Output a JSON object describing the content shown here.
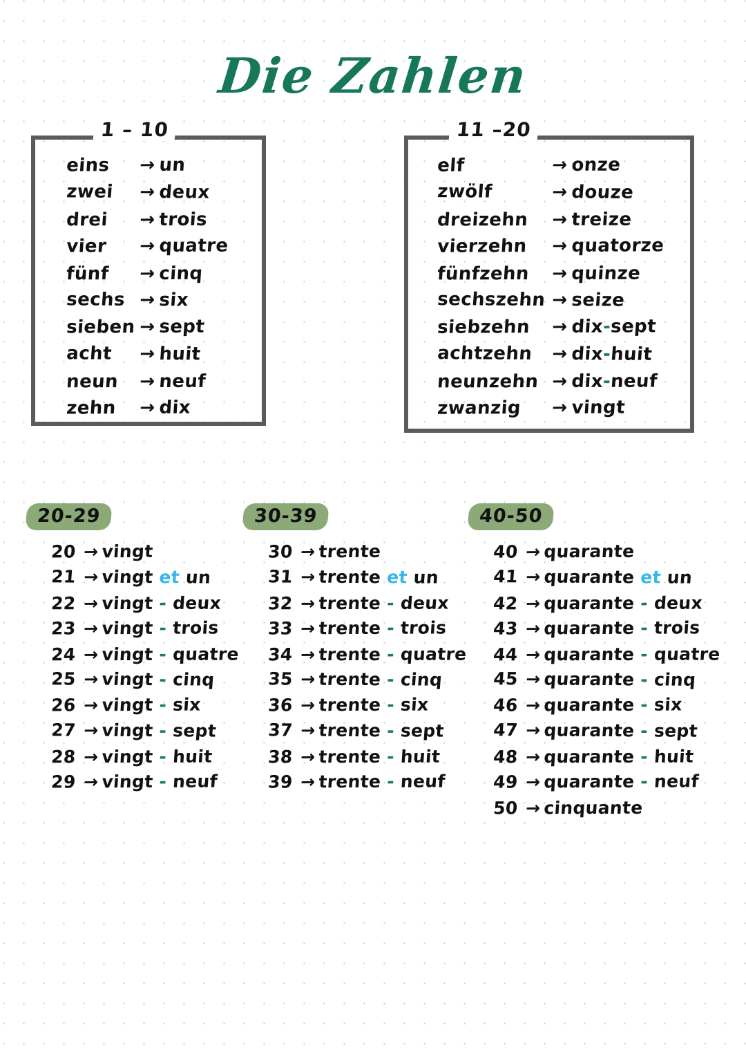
{
  "page": {
    "title": "Die Zahlen",
    "background": "#ffffff",
    "dot_grid_color": "#c9c9cf"
  },
  "colors": {
    "title_green": "#17775a",
    "highlight_pill_green": "#8ca978",
    "dash_green": "#167d63",
    "et_blue": "#3ab5e8",
    "box_border_gray": "#5b5b5b",
    "ink_black": "#111111"
  },
  "arrow_glyph": "→",
  "boxes": [
    {
      "legend": "1 – 10",
      "pairs": [
        {
          "de": "eins",
          "arrow": "→",
          "fr": "un"
        },
        {
          "de": "zwei",
          "arrow": "→",
          "fr": "deux"
        },
        {
          "de": "drei",
          "arrow": "→",
          "fr": "trois"
        },
        {
          "de": "vier",
          "arrow": "→",
          "fr": "quatre"
        },
        {
          "de": "fünf",
          "arrow": "→",
          "fr": "cinq"
        },
        {
          "de": "sechs",
          "arrow": "→",
          "fr": "six"
        },
        {
          "de": "sieben",
          "arrow": "→",
          "fr": "sept"
        },
        {
          "de": "acht",
          "arrow": "→",
          "fr": "huit"
        },
        {
          "de": "neun",
          "arrow": "→",
          "fr": "neuf"
        },
        {
          "de": "zehn",
          "arrow": "→",
          "fr": "dix"
        }
      ]
    },
    {
      "legend": "11 –20",
      "pairs": [
        {
          "de": "elf",
          "arrow": "→",
          "fr": "onze"
        },
        {
          "de": "zwölf",
          "arrow": "→",
          "fr": "douze"
        },
        {
          "de": "dreizehn",
          "arrow": "→",
          "fr": "treize"
        },
        {
          "de": "vierzehn",
          "arrow": "→",
          "fr": "quatorze"
        },
        {
          "de": "fünfzehn",
          "arrow": "→",
          "fr": "quinze"
        },
        {
          "de": "sechszehn",
          "arrow": "→",
          "fr": "seize"
        },
        {
          "de": "siebzehn",
          "arrow": "→",
          "fr": "dix-sept",
          "fr_parts": [
            "dix",
            "-",
            "sept"
          ]
        },
        {
          "de": "achtzehn",
          "arrow": "→",
          "fr": "dix-huit",
          "fr_parts": [
            "dix",
            "-",
            "huit"
          ]
        },
        {
          "de": "neunzehn",
          "arrow": "→",
          "fr": "dix-neuf",
          "fr_parts": [
            "dix",
            "-",
            "neuf"
          ]
        },
        {
          "de": "zwanzig",
          "arrow": "→",
          "fr": "vingt"
        }
      ]
    }
  ],
  "groups": [
    {
      "header": "20-29",
      "rows": [
        {
          "num": "20",
          "arrow": "→",
          "base": "vingt",
          "sep": "",
          "tail": ""
        },
        {
          "num": "21",
          "arrow": "→",
          "base": "vingt",
          "sep": "et",
          "tail": "un"
        },
        {
          "num": "22",
          "arrow": "→",
          "base": "vingt",
          "sep": "-",
          "tail": "deux"
        },
        {
          "num": "23",
          "arrow": "→",
          "base": "vingt",
          "sep": "-",
          "tail": "trois"
        },
        {
          "num": "24",
          "arrow": "→",
          "base": "vingt",
          "sep": "-",
          "tail": "quatre"
        },
        {
          "num": "25",
          "arrow": "→",
          "base": "vingt",
          "sep": "-",
          "tail": "cinq"
        },
        {
          "num": "26",
          "arrow": "→",
          "base": "vingt",
          "sep": "-",
          "tail": "six"
        },
        {
          "num": "27",
          "arrow": "→",
          "base": "vingt",
          "sep": "-",
          "tail": "sept"
        },
        {
          "num": "28",
          "arrow": "→",
          "base": "vingt",
          "sep": "-",
          "tail": "huit"
        },
        {
          "num": "29",
          "arrow": "→",
          "base": "vingt",
          "sep": "-",
          "tail": "neuf"
        }
      ]
    },
    {
      "header": "30-39",
      "rows": [
        {
          "num": "30",
          "arrow": "→",
          "base": "trente",
          "sep": "",
          "tail": ""
        },
        {
          "num": "31",
          "arrow": "→",
          "base": "trente",
          "sep": "et",
          "tail": "un"
        },
        {
          "num": "32",
          "arrow": "→",
          "base": "trente",
          "sep": "-",
          "tail": "deux"
        },
        {
          "num": "33",
          "arrow": "→",
          "base": "trente",
          "sep": "-",
          "tail": "trois"
        },
        {
          "num": "34",
          "arrow": "→",
          "base": "trente",
          "sep": "-",
          "tail": "quatre"
        },
        {
          "num": "35",
          "arrow": "→",
          "base": "trente",
          "sep": "-",
          "tail": "cinq"
        },
        {
          "num": "36",
          "arrow": "→",
          "base": "trente",
          "sep": "-",
          "tail": "six"
        },
        {
          "num": "37",
          "arrow": "→",
          "base": "trente",
          "sep": "-",
          "tail": "sept"
        },
        {
          "num": "38",
          "arrow": "→",
          "base": "trente",
          "sep": "-",
          "tail": "huit"
        },
        {
          "num": "39",
          "arrow": "→",
          "base": "trente",
          "sep": "-",
          "tail": "neuf"
        }
      ]
    },
    {
      "header": "40-50",
      "rows": [
        {
          "num": "40",
          "arrow": "→",
          "base": "quarante",
          "sep": "",
          "tail": ""
        },
        {
          "num": "41",
          "arrow": "→",
          "base": "quarante",
          "sep": "et",
          "tail": "un"
        },
        {
          "num": "42",
          "arrow": "→",
          "base": "quarante",
          "sep": "-",
          "tail": "deux"
        },
        {
          "num": "43",
          "arrow": "→",
          "base": "quarante",
          "sep": "-",
          "tail": "trois"
        },
        {
          "num": "44",
          "arrow": "→",
          "base": "quarante",
          "sep": "-",
          "tail": "quatre"
        },
        {
          "num": "45",
          "arrow": "→",
          "base": "quarante",
          "sep": "-",
          "tail": "cinq"
        },
        {
          "num": "46",
          "arrow": "→",
          "base": "quarante",
          "sep": "-",
          "tail": "six"
        },
        {
          "num": "47",
          "arrow": "→",
          "base": "quarante",
          "sep": "-",
          "tail": "sept"
        },
        {
          "num": "48",
          "arrow": "→",
          "base": "quarante",
          "sep": "-",
          "tail": "huit"
        },
        {
          "num": "49",
          "arrow": "→",
          "base": "quarante",
          "sep": "-",
          "tail": "neuf"
        },
        {
          "num": "50",
          "arrow": "→",
          "base": "cinquante",
          "sep": "",
          "tail": ""
        }
      ]
    }
  ]
}
